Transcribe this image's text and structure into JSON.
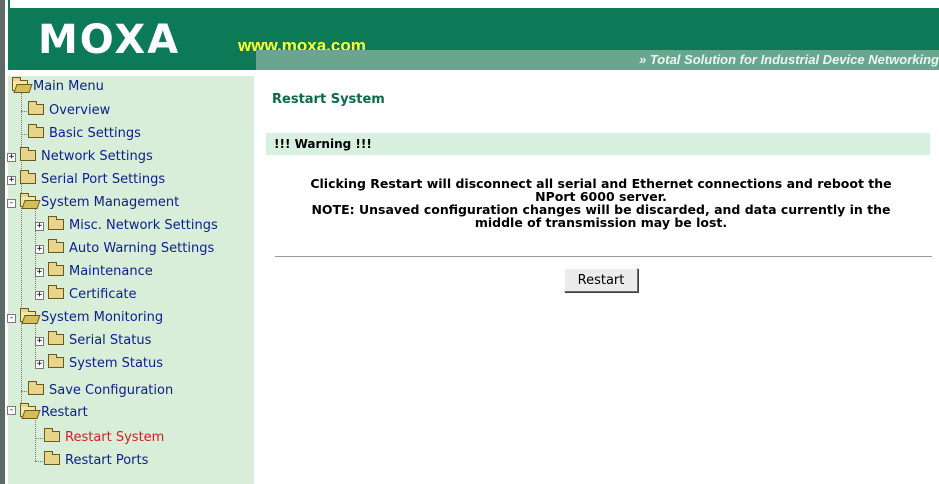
{
  "header": {
    "logo": "MOXA",
    "url": "www.moxa.com",
    "tagline": "» Total Solution for Industrial Device Networking"
  },
  "menu": {
    "items": [
      {
        "label": "Main Menu",
        "level": 0,
        "icon": "folder-open-icon"
      },
      {
        "label": "Overview",
        "level": 1,
        "icon": "folder-icon"
      },
      {
        "label": "Basic Settings",
        "level": 1,
        "icon": "folder-icon"
      },
      {
        "label": "Network Settings",
        "level": 1,
        "icon": "folder-icon",
        "expander": "+"
      },
      {
        "label": "Serial Port Settings",
        "level": 1,
        "icon": "folder-icon",
        "expander": "+"
      },
      {
        "label": "System Management",
        "level": 1,
        "icon": "folder-open-icon",
        "expander": "-"
      },
      {
        "label": "Misc. Network Settings",
        "level": 2,
        "icon": "folder-icon",
        "expander": "+"
      },
      {
        "label": "Auto Warning Settings",
        "level": 2,
        "icon": "folder-icon",
        "expander": "+"
      },
      {
        "label": "Maintenance",
        "level": 2,
        "icon": "folder-icon",
        "expander": "+"
      },
      {
        "label": "Certificate",
        "level": 2,
        "icon": "folder-icon",
        "expander": "+"
      },
      {
        "label": "System Monitoring",
        "level": 1,
        "icon": "folder-open-icon",
        "expander": "-"
      },
      {
        "label": "Serial Status",
        "level": 2,
        "icon": "folder-icon",
        "expander": "+"
      },
      {
        "label": "System Status",
        "level": 2,
        "icon": "folder-icon",
        "expander": "+"
      },
      {
        "label": "Save Configuration",
        "level": 1,
        "icon": "folder-icon"
      },
      {
        "label": "Restart",
        "level": 1,
        "icon": "folder-open-icon",
        "expander": "-"
      },
      {
        "label": "Restart System",
        "level": 2,
        "icon": "folder-icon",
        "active": true
      },
      {
        "label": "Restart Ports",
        "level": 2,
        "icon": "folder-icon"
      }
    ]
  },
  "main": {
    "title": "Restart System",
    "warning_title": "!!! Warning !!!",
    "message_line1": "Clicking Restart will disconnect all serial and Ethernet connections and reboot the",
    "message_line2": "NPort 6000 server.",
    "message_line3": "NOTE: Unsaved configuration changes will be discarded, and data currently in the",
    "message_line4": "middle of transmission may be lost.",
    "button_label": "Restart"
  },
  "colors": {
    "header": "#0c7a57",
    "sidebar": "#d8eed9",
    "active_item": "#d02020",
    "link": "#0d1d8e"
  }
}
